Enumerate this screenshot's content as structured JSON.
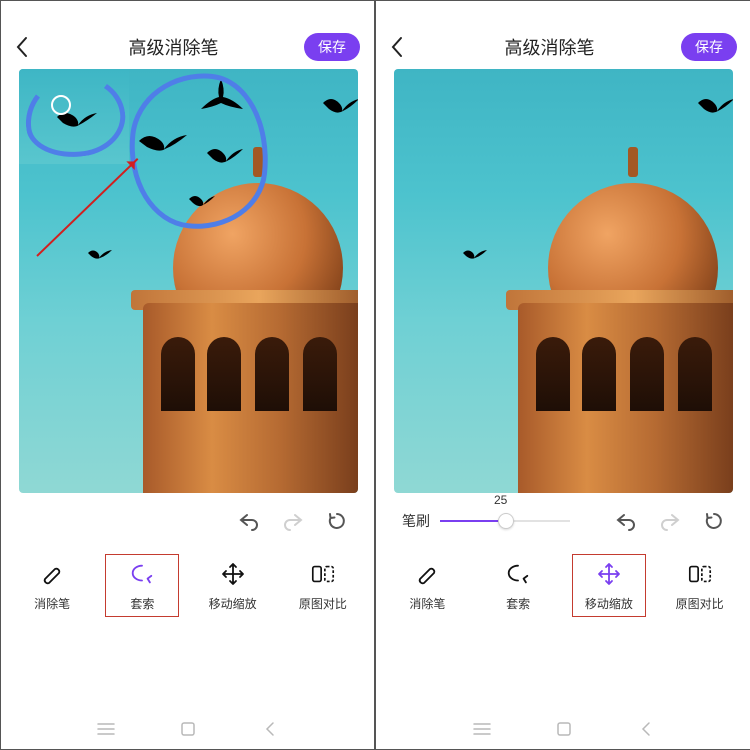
{
  "left": {
    "header": {
      "title": "高级消除笔",
      "save": "保存"
    },
    "slider": {
      "enabled": false
    },
    "tools": [
      {
        "id": "eraser",
        "label": "消除笔",
        "selected": false
      },
      {
        "id": "lasso",
        "label": "套索",
        "selected": true
      },
      {
        "id": "move",
        "label": "移动缩放",
        "selected": false
      },
      {
        "id": "compare",
        "label": "原图对比",
        "selected": false
      }
    ],
    "birds_removed": false
  },
  "right": {
    "header": {
      "title": "高级消除笔",
      "save": "保存"
    },
    "slider": {
      "enabled": true,
      "label": "笔刷",
      "value": 25,
      "min": 0,
      "max": 100
    },
    "tools": [
      {
        "id": "eraser",
        "label": "消除笔",
        "selected": false
      },
      {
        "id": "lasso",
        "label": "套索",
        "selected": false
      },
      {
        "id": "move",
        "label": "移动缩放",
        "selected": true
      },
      {
        "id": "compare",
        "label": "原图对比",
        "selected": false
      }
    ],
    "birds_removed": true
  },
  "colors": {
    "accent": "#7a3ff0",
    "annotation_box": "#c43b2f",
    "lasso": "#4f7ee8",
    "arrow": "#d21f1f"
  }
}
